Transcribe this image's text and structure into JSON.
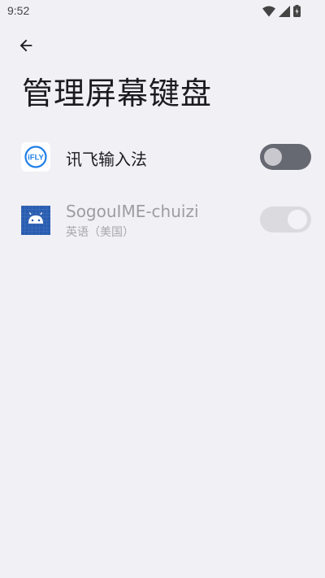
{
  "status_bar": {
    "time": "9:52",
    "icons": [
      "wifi-icon",
      "cellular-signal-icon",
      "battery-icon"
    ]
  },
  "header": {
    "back_icon": "arrow-left-icon",
    "title": "管理屏幕键盘"
  },
  "keyboards": [
    {
      "name": "讯飞输入法",
      "subtitle": "",
      "icon": "ifly-app-icon",
      "icon_label": "iFLY",
      "toggle_state": "off",
      "enabled": true
    },
    {
      "name": "SogouIME-chuizi",
      "subtitle": "英语（美国）",
      "icon": "android-app-icon",
      "toggle_state": "on",
      "enabled": false
    }
  ],
  "colors": {
    "background": "#f1f0f5",
    "toggle_off_track": "#666872",
    "ifly_blue": "#1f7fe6",
    "android_icon_blue": "#2a5db0"
  }
}
